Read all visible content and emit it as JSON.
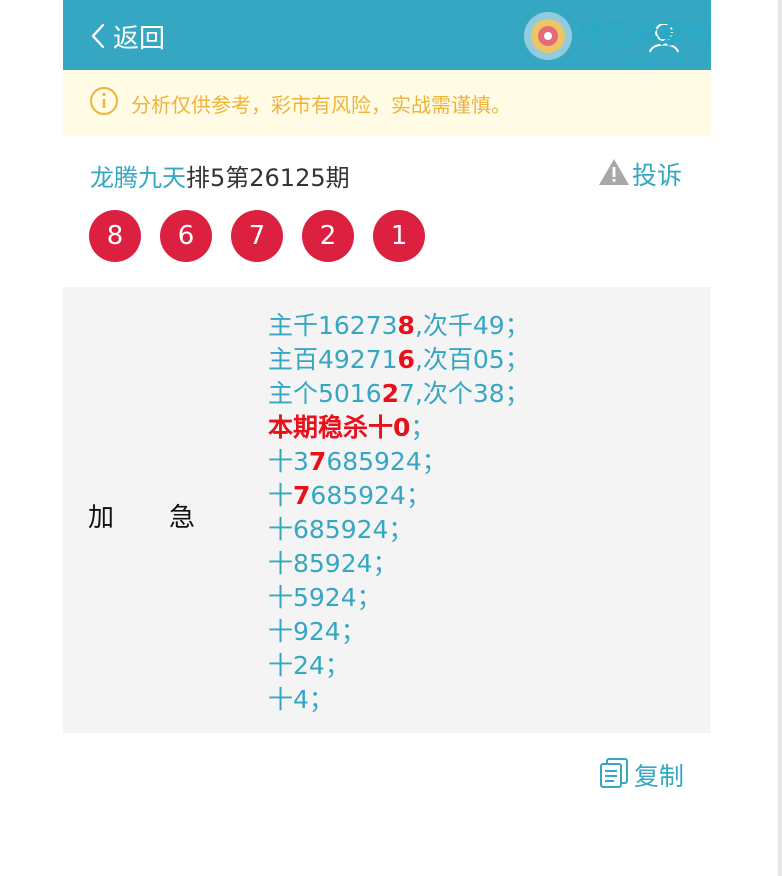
{
  "header": {
    "back_label": "返回"
  },
  "logo": {
    "text": "特区彩票网",
    "url": "www.tqcp.net"
  },
  "notice": {
    "text": "分析仅供参考，彩市有风险，实战需谨慎。"
  },
  "title": {
    "name": "龙腾九天",
    "rest": "排5第26125期"
  },
  "complain_label": "投诉",
  "balls": [
    "8",
    "6",
    "7",
    "2",
    "1"
  ],
  "content": {
    "label_a": "加",
    "label_b": "急",
    "lines": [
      {
        "pre": "主千16273",
        "hl": "8",
        "post": ",次千49；"
      },
      {
        "pre": "主百49271",
        "hl": "6",
        "post": ",次百05；"
      },
      {
        "pre": "主个5016",
        "hl": "2",
        "post": "7,次个38；"
      },
      {
        "red": "本期稳杀十0",
        "post": "；"
      },
      {
        "pre": "十3",
        "hl": "7",
        "post": "685924；"
      },
      {
        "pre": "十",
        "hl": "7",
        "post": "685924；"
      },
      {
        "pre": "十685924；"
      },
      {
        "pre": "十85924；"
      },
      {
        "pre": "十5924；"
      },
      {
        "pre": "十924；"
      },
      {
        "pre": "十24；"
      },
      {
        "pre": "十4；"
      }
    ]
  },
  "copy_label": "复制",
  "colors": {
    "primary": "#36a7c2",
    "ball": "#dc2040",
    "highlight": "#e8101b",
    "notice_bg": "#fffbe5",
    "notice_text": "#f0b33a"
  }
}
